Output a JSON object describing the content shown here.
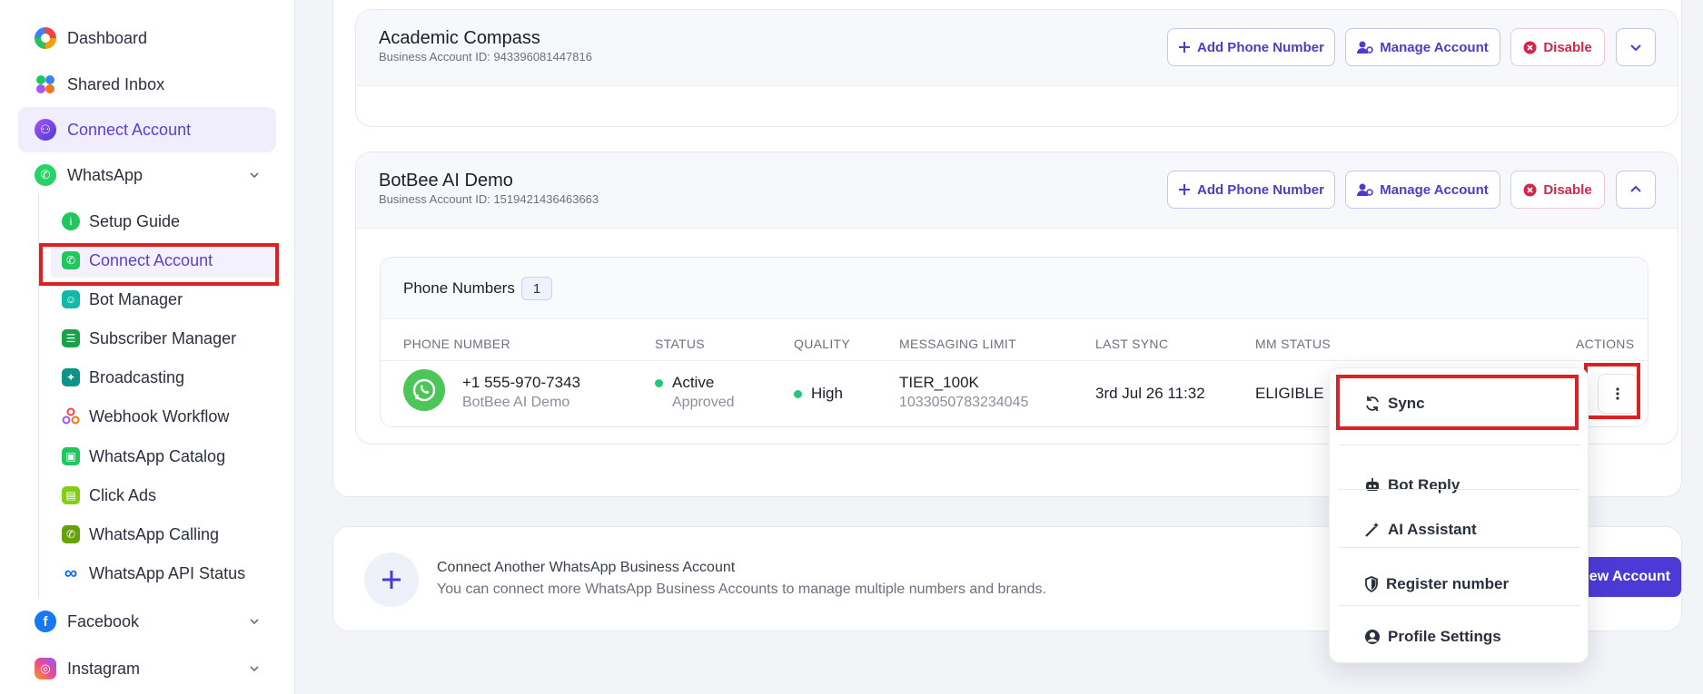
{
  "sidebar": {
    "items": [
      {
        "label": "Dashboard",
        "icon": "dashboard-icon"
      },
      {
        "label": "Shared Inbox",
        "icon": "shared-inbox-icon"
      },
      {
        "label": "Connect Account",
        "icon": "connect-account-icon"
      },
      {
        "label": "WhatsApp",
        "icon": "whatsapp-icon"
      },
      {
        "label": "Facebook",
        "icon": "facebook-icon"
      },
      {
        "label": "Instagram",
        "icon": "instagram-icon"
      }
    ],
    "whatsapp_sub": [
      {
        "label": "Setup Guide",
        "icon": "info-icon"
      },
      {
        "label": "Connect Account",
        "icon": "whatsapp-connect-icon"
      },
      {
        "label": "Bot Manager",
        "icon": "bot-icon"
      },
      {
        "label": "Subscriber Manager",
        "icon": "subscriber-icon"
      },
      {
        "label": "Broadcasting",
        "icon": "broadcast-icon"
      },
      {
        "label": "Webhook Workflow",
        "icon": "webhook-icon"
      },
      {
        "label": "WhatsApp Catalog",
        "icon": "catalog-bag-icon"
      },
      {
        "label": "Click Ads",
        "icon": "click-ads-icon"
      },
      {
        "label": "WhatsApp Calling",
        "icon": "calling-icon"
      },
      {
        "label": "WhatsApp API Status",
        "icon": "meta-infinity-icon"
      }
    ]
  },
  "accounts": [
    {
      "name": "Academic Compass",
      "id_text": "Business Account ID: 943396081447816",
      "add_phone": "Add Phone Number",
      "manage": "Manage Account",
      "disable": "Disable"
    },
    {
      "name": "BotBee AI Demo",
      "id_text": "Business Account ID: 1519421436463663",
      "add_phone": "Add Phone Number",
      "manage": "Manage Account",
      "disable": "Disable"
    }
  ],
  "phone_numbers": {
    "title": "Phone Numbers",
    "count": "1",
    "columns": [
      "PHONE NUMBER",
      "STATUS",
      "QUALITY",
      "MESSAGING LIMIT",
      "LAST SYNC",
      "MM STATUS",
      "ACTIONS"
    ],
    "row": {
      "number": "+1 555-970-7343",
      "name": "BotBee AI Demo",
      "status": "Active",
      "status_sub": "Approved",
      "quality": "High",
      "limit": "TIER_100K",
      "limit_sub": "1033050783234045",
      "last_sync": "3rd Jul 26 11:32",
      "mm_status": "ELIGIBLE"
    }
  },
  "dropdown": {
    "items": [
      {
        "label": "Sync",
        "icon": "sync-icon"
      },
      {
        "label": "Bot Reply",
        "icon": "robot-icon"
      },
      {
        "label": "AI Assistant",
        "icon": "magic-wand-icon"
      },
      {
        "label": "Register number",
        "icon": "shield-icon"
      },
      {
        "label": "Profile Settings",
        "icon": "user-circle-icon"
      }
    ]
  },
  "connect_another": {
    "title": "Connect Another WhatsApp Business Account",
    "subtitle": "You can connect more WhatsApp Business Accounts to manage multiple numbers and brands.",
    "button": "ew Account"
  },
  "colors": {
    "accent": "#4b3ad6",
    "whatsapp_green": "#4cc659",
    "highlight_red": "#e02020",
    "status_green": "#22c77a",
    "disable_red": "#d3274a"
  }
}
